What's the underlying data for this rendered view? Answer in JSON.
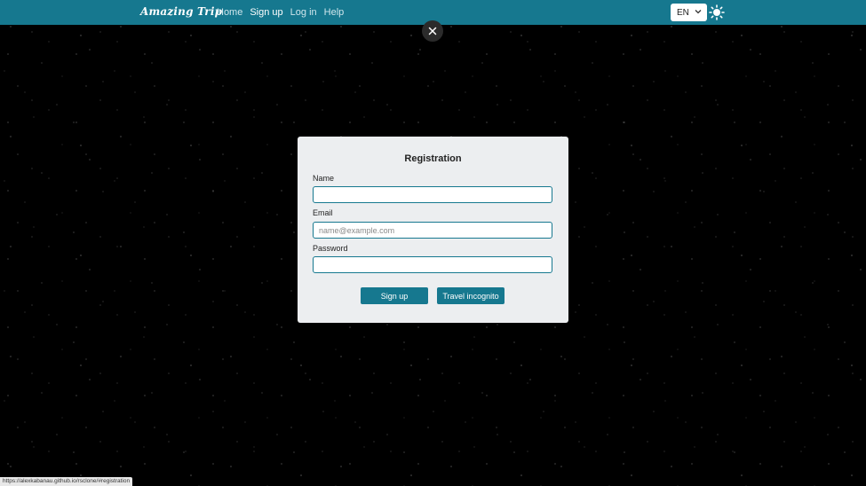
{
  "navbar": {
    "brand": "Amazing Trip",
    "links": [
      {
        "label": "Home",
        "active": false
      },
      {
        "label": "Sign up",
        "active": true
      },
      {
        "label": "Log in",
        "active": false
      },
      {
        "label": "Help",
        "active": false
      }
    ],
    "language": "EN",
    "accent_color": "#16788f"
  },
  "close_icon": "close-icon",
  "modal": {
    "title": "Registration",
    "fields": {
      "name": {
        "label": "Name",
        "value": "",
        "placeholder": ""
      },
      "email": {
        "label": "Email",
        "value": "",
        "placeholder": "name@example.com"
      },
      "password": {
        "label": "Password",
        "value": "",
        "placeholder": ""
      }
    },
    "buttons": {
      "signup": "Sign up",
      "incognito": "Travel incognito"
    }
  },
  "status_bar": {
    "url": "https://alexkabanau.github.io/rsclone/#registration"
  },
  "icons": {
    "language_dropdown": "chevron-down-icon",
    "theme_toggle": "sun-icon"
  }
}
